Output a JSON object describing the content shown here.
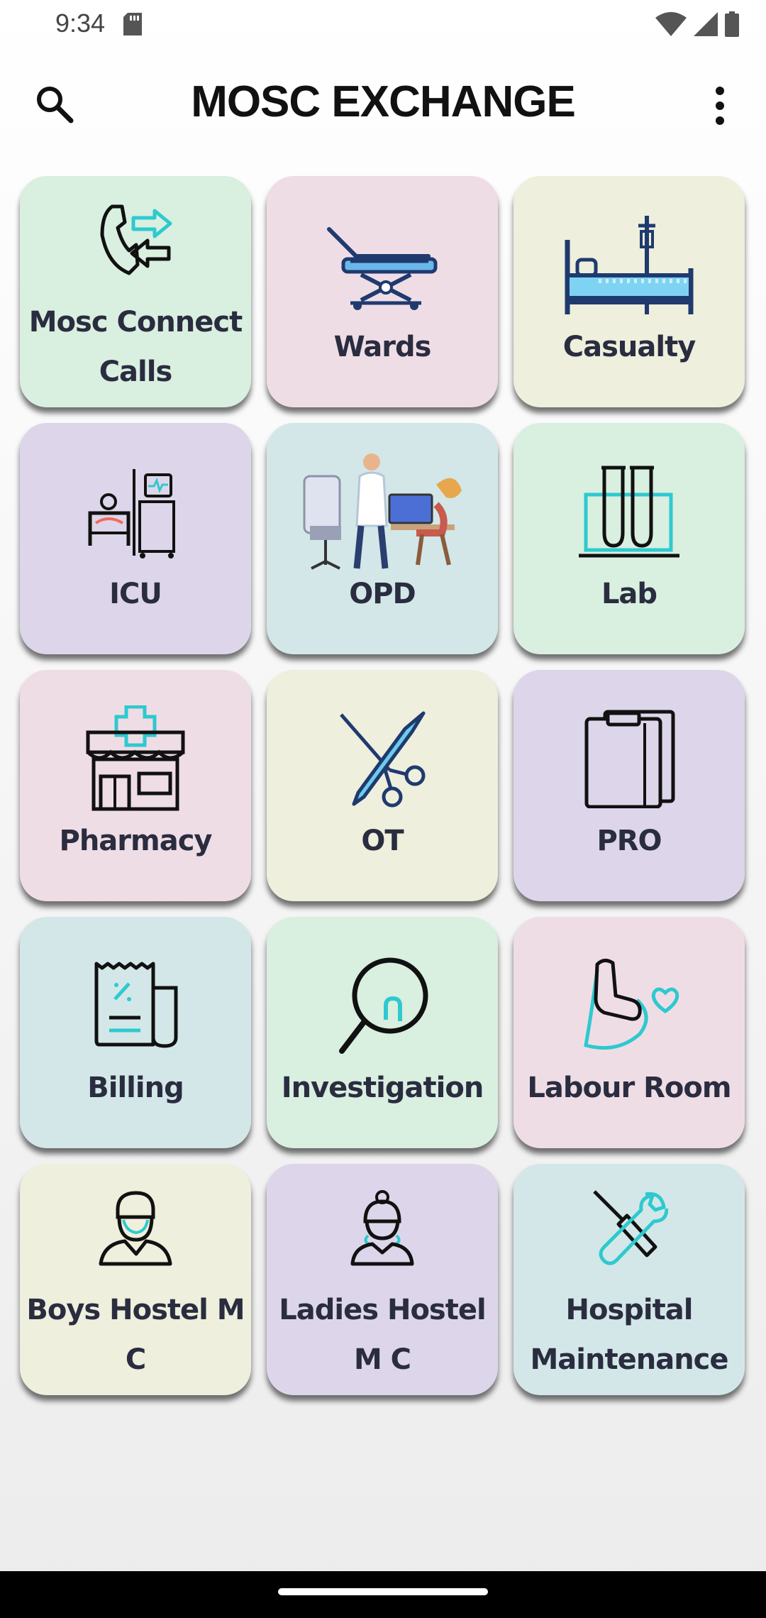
{
  "status": {
    "time": "9:34"
  },
  "app": {
    "title": "MOSC EXCHANGE"
  },
  "tiles": [
    {
      "label": "Mosc Connect Calls",
      "icon": "phone-transfer-icon",
      "bg": "#d9efe0"
    },
    {
      "label": "Wards",
      "icon": "stretcher-icon",
      "bg": "#efdde6"
    },
    {
      "label": "Casualty",
      "icon": "hospital-bed-icon",
      "bg": "#eeefdc"
    },
    {
      "label": "ICU",
      "icon": "icu-patient-icon",
      "bg": "#ddd6ea"
    },
    {
      "label": "OPD",
      "icon": "doctor-consultation-icon",
      "bg": "#d3e7e8"
    },
    {
      "label": "Lab",
      "icon": "test-tubes-icon",
      "bg": "#d9efe0"
    },
    {
      "label": "Pharmacy",
      "icon": "pharmacy-store-icon",
      "bg": "#efdde6"
    },
    {
      "label": "OT",
      "icon": "surgical-tools-icon",
      "bg": "#eeefdc"
    },
    {
      "label": "PRO",
      "icon": "clipboard-icon",
      "bg": "#ddd6ea"
    },
    {
      "label": "Billing",
      "icon": "receipt-icon",
      "bg": "#d3e7e8"
    },
    {
      "label": "Investigation",
      "icon": "magnifier-icon",
      "bg": "#d9efe0"
    },
    {
      "label": "Labour Room",
      "icon": "pregnancy-icon",
      "bg": "#efdde6"
    },
    {
      "label": "Boys Hostel M C",
      "icon": "male-person-icon",
      "bg": "#eeefdc"
    },
    {
      "label": "Ladies Hostel M C",
      "icon": "female-person-icon",
      "bg": "#ddd6ea"
    },
    {
      "label": "Hospital Maintenance",
      "icon": "tools-icon",
      "bg": "#d3e7e8"
    }
  ]
}
